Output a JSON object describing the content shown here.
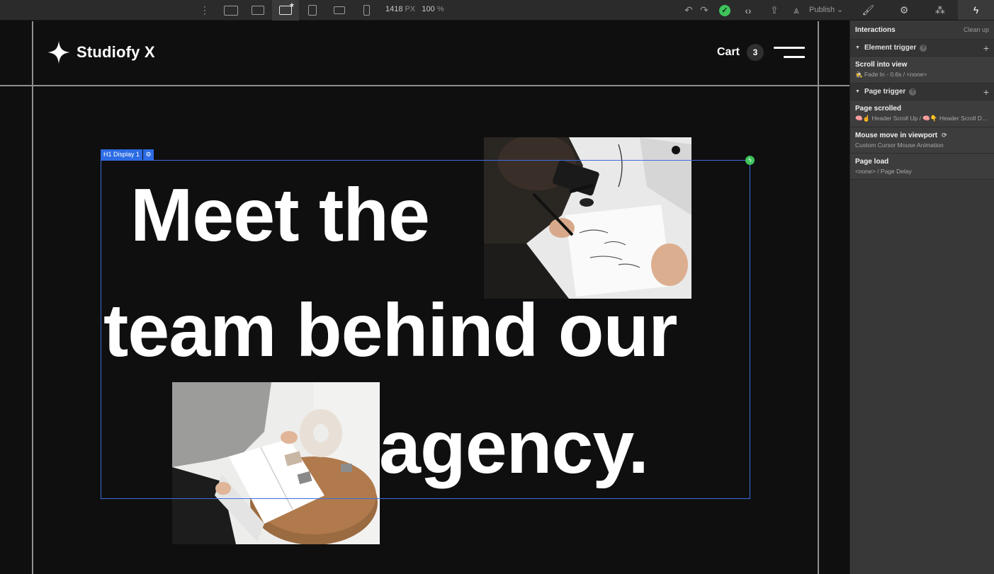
{
  "toolbar": {
    "canvas_width": "1418",
    "canvas_width_unit": "PX",
    "zoom": "100",
    "zoom_unit": "%",
    "publish_label": "Publish"
  },
  "panel": {
    "title": "Interactions",
    "clean_up": "Clean up",
    "element_trigger": {
      "label": "Element trigger",
      "items": [
        {
          "name": "Scroll into view",
          "detail": "🕵 Fade In - 0.6s / <none>"
        }
      ]
    },
    "page_trigger": {
      "label": "Page trigger",
      "items": [
        {
          "name": "Page scrolled",
          "detail": "🧠☝ Header Scroll Up / 🧠👇 Header Scroll Down"
        },
        {
          "name": "Mouse move in viewport",
          "detail": "Custom Cursor Mouse Animation"
        },
        {
          "name": "Page load",
          "detail": "<none> / Page Delay"
        }
      ]
    }
  },
  "site": {
    "logo_text": "Studiofy X",
    "cart_label": "Cart",
    "cart_count": "3"
  },
  "selection": {
    "tag": "H1 Display 1"
  },
  "hero": {
    "line1": "Meet the",
    "line2": "team behind our",
    "line3": "agency."
  },
  "colors": {
    "canvas_bg": "#0f0f0f",
    "selection_blue": "#2b6be4",
    "status_green": "#3ec45b",
    "panel_bg": "#383838"
  }
}
